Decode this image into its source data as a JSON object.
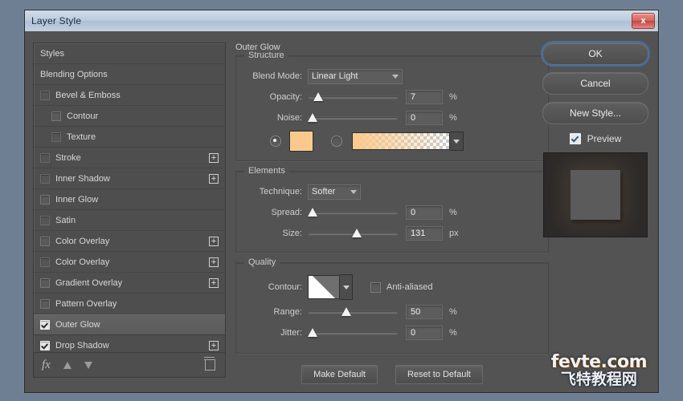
{
  "window": {
    "title": "Layer Style",
    "close_label": "x"
  },
  "styles_panel": {
    "items": [
      {
        "label": "Styles",
        "checkbox": "none",
        "plus": false,
        "indent": false,
        "selected": false
      },
      {
        "label": "Blending Options",
        "checkbox": "none",
        "plus": false,
        "indent": false,
        "selected": false
      },
      {
        "label": "Bevel & Emboss",
        "checkbox": "dim",
        "plus": false,
        "indent": false,
        "selected": false
      },
      {
        "label": "Contour",
        "checkbox": "empty",
        "plus": false,
        "indent": true,
        "selected": false
      },
      {
        "label": "Texture",
        "checkbox": "dim",
        "plus": false,
        "indent": true,
        "selected": false
      },
      {
        "label": "Stroke",
        "checkbox": "dim",
        "plus": true,
        "indent": false,
        "selected": false
      },
      {
        "label": "Inner Shadow",
        "checkbox": "dim",
        "plus": true,
        "indent": false,
        "selected": false
      },
      {
        "label": "Inner Glow",
        "checkbox": "empty",
        "plus": false,
        "indent": false,
        "selected": false
      },
      {
        "label": "Satin",
        "checkbox": "dim",
        "plus": false,
        "indent": false,
        "selected": false
      },
      {
        "label": "Color Overlay",
        "checkbox": "empty",
        "plus": true,
        "indent": false,
        "selected": false
      },
      {
        "label": "Color Overlay",
        "checkbox": "dim",
        "plus": true,
        "indent": false,
        "selected": false
      },
      {
        "label": "Gradient Overlay",
        "checkbox": "empty",
        "plus": true,
        "indent": false,
        "selected": false
      },
      {
        "label": "Pattern Overlay",
        "checkbox": "empty",
        "plus": false,
        "indent": false,
        "selected": false
      },
      {
        "label": "Outer Glow",
        "checkbox": "checked",
        "plus": false,
        "indent": false,
        "selected": true
      },
      {
        "label": "Drop Shadow",
        "checkbox": "checked",
        "plus": true,
        "indent": false,
        "selected": false
      }
    ],
    "footer": {
      "fx_icon": "fx-icon",
      "up_icon": "arrow-up-icon",
      "down_icon": "arrow-down-icon",
      "trash_icon": "trash-icon"
    }
  },
  "main": {
    "panel_title": "Outer Glow",
    "structure": {
      "legend": "Structure",
      "blend_mode_label": "Blend Mode:",
      "blend_mode_value": "Linear Light",
      "opacity_label": "Opacity:",
      "opacity_value": "7",
      "opacity_unit": "%",
      "opacity_pct": 7,
      "noise_label": "Noise:",
      "noise_value": "0",
      "noise_unit": "%",
      "noise_pct": 0,
      "fill_mode": "color",
      "color_hex": "#fbc98b",
      "gradient_from": "#fbc98b",
      "gradient_to": "rgba(251,201,139,0)"
    },
    "elements": {
      "legend": "Elements",
      "technique_label": "Technique:",
      "technique_value": "Softer",
      "spread_label": "Spread:",
      "spread_value": "0",
      "spread_unit": "%",
      "spread_pct": 0,
      "size_label": "Size:",
      "size_value": "131",
      "size_unit": "px",
      "size_pct": 55
    },
    "quality": {
      "legend": "Quality",
      "contour_label": "Contour:",
      "antialiased_label": "Anti-aliased",
      "antialiased_checked": false,
      "range_label": "Range:",
      "range_value": "50",
      "range_unit": "%",
      "range_pct": 42,
      "jitter_label": "Jitter:",
      "jitter_value": "0",
      "jitter_unit": "%",
      "jitter_pct": 0
    },
    "make_default_label": "Make Default",
    "reset_default_label": "Reset to Default"
  },
  "actions": {
    "ok_label": "OK",
    "cancel_label": "Cancel",
    "new_style_label": "New Style...",
    "preview_label": "Preview",
    "preview_checked": true
  },
  "watermark": {
    "line1": "fevte.com",
    "line2": "飞特教程网"
  },
  "colors": {
    "dialog_bg": "#535353",
    "titlebar": "#bccce0",
    "glow_color": "#fbc98b",
    "focus_ring": "#3f6fa8",
    "close_red": "#d5635c"
  }
}
